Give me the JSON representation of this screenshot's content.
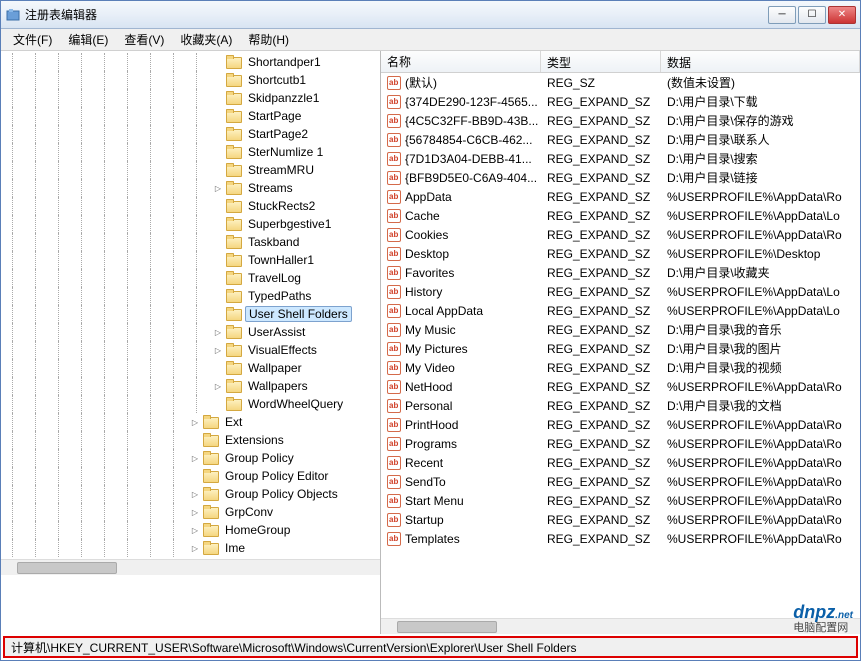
{
  "window": {
    "title": "注册表编辑器"
  },
  "menubar": {
    "items": [
      "文件(F)",
      "编辑(E)",
      "查看(V)",
      "收藏夹(A)",
      "帮助(H)"
    ]
  },
  "tree": {
    "items": [
      {
        "label": "Shortandper1",
        "indent": 9,
        "exp": false
      },
      {
        "label": "Shortcutb1",
        "indent": 9,
        "exp": false
      },
      {
        "label": "Skidpanzzle1",
        "indent": 9,
        "exp": false
      },
      {
        "label": "StartPage",
        "indent": 9,
        "exp": false
      },
      {
        "label": "StartPage2",
        "indent": 9,
        "exp": false
      },
      {
        "label": "SterNumlize 1",
        "indent": 9,
        "exp": false
      },
      {
        "label": "StreamMRU",
        "indent": 9,
        "exp": false
      },
      {
        "label": "Streams",
        "indent": 9,
        "exp": true
      },
      {
        "label": "StuckRects2",
        "indent": 9,
        "exp": false
      },
      {
        "label": "Superbgestive1",
        "indent": 9,
        "exp": false
      },
      {
        "label": "Taskband",
        "indent": 9,
        "exp": false
      },
      {
        "label": "TownHaller1",
        "indent": 9,
        "exp": false
      },
      {
        "label": "TravelLog",
        "indent": 9,
        "exp": false
      },
      {
        "label": "TypedPaths",
        "indent": 9,
        "exp": false
      },
      {
        "label": "User Shell Folders",
        "indent": 9,
        "exp": false,
        "selected": true
      },
      {
        "label": "UserAssist",
        "indent": 9,
        "exp": true
      },
      {
        "label": "VisualEffects",
        "indent": 9,
        "exp": true
      },
      {
        "label": "Wallpaper",
        "indent": 9,
        "exp": false
      },
      {
        "label": "Wallpapers",
        "indent": 9,
        "exp": true
      },
      {
        "label": "WordWheelQuery",
        "indent": 9,
        "exp": false
      },
      {
        "label": "Ext",
        "indent": 8,
        "exp": true
      },
      {
        "label": "Extensions",
        "indent": 8,
        "exp": false
      },
      {
        "label": "Group Policy",
        "indent": 8,
        "exp": true
      },
      {
        "label": "Group Policy Editor",
        "indent": 8,
        "exp": false
      },
      {
        "label": "Group Policy Objects",
        "indent": 8,
        "exp": true
      },
      {
        "label": "GrpConv",
        "indent": 8,
        "exp": true
      },
      {
        "label": "HomeGroup",
        "indent": 8,
        "exp": true
      },
      {
        "label": "Ime",
        "indent": 8,
        "exp": true
      }
    ]
  },
  "list": {
    "headers": [
      "名称",
      "类型",
      "数据"
    ],
    "rows": [
      {
        "name": "(默认)",
        "type": "REG_SZ",
        "data": "(数值未设置)"
      },
      {
        "name": "{374DE290-123F-4565...",
        "type": "REG_EXPAND_SZ",
        "data": "D:\\用户目录\\下载"
      },
      {
        "name": "{4C5C32FF-BB9D-43B...",
        "type": "REG_EXPAND_SZ",
        "data": "D:\\用户目录\\保存的游戏"
      },
      {
        "name": "{56784854-C6CB-462...",
        "type": "REG_EXPAND_SZ",
        "data": "D:\\用户目录\\联系人"
      },
      {
        "name": "{7D1D3A04-DEBB-41...",
        "type": "REG_EXPAND_SZ",
        "data": "D:\\用户目录\\搜索"
      },
      {
        "name": "{BFB9D5E0-C6A9-404...",
        "type": "REG_EXPAND_SZ",
        "data": "D:\\用户目录\\链接"
      },
      {
        "name": "AppData",
        "type": "REG_EXPAND_SZ",
        "data": "%USERPROFILE%\\AppData\\Ro"
      },
      {
        "name": "Cache",
        "type": "REG_EXPAND_SZ",
        "data": "%USERPROFILE%\\AppData\\Lo"
      },
      {
        "name": "Cookies",
        "type": "REG_EXPAND_SZ",
        "data": "%USERPROFILE%\\AppData\\Ro"
      },
      {
        "name": "Desktop",
        "type": "REG_EXPAND_SZ",
        "data": "%USERPROFILE%\\Desktop"
      },
      {
        "name": "Favorites",
        "type": "REG_EXPAND_SZ",
        "data": "D:\\用户目录\\收藏夹"
      },
      {
        "name": "History",
        "type": "REG_EXPAND_SZ",
        "data": "%USERPROFILE%\\AppData\\Lo"
      },
      {
        "name": "Local AppData",
        "type": "REG_EXPAND_SZ",
        "data": "%USERPROFILE%\\AppData\\Lo"
      },
      {
        "name": "My Music",
        "type": "REG_EXPAND_SZ",
        "data": "D:\\用户目录\\我的音乐"
      },
      {
        "name": "My Pictures",
        "type": "REG_EXPAND_SZ",
        "data": "D:\\用户目录\\我的图片"
      },
      {
        "name": "My Video",
        "type": "REG_EXPAND_SZ",
        "data": "D:\\用户目录\\我的视频"
      },
      {
        "name": "NetHood",
        "type": "REG_EXPAND_SZ",
        "data": "%USERPROFILE%\\AppData\\Ro"
      },
      {
        "name": "Personal",
        "type": "REG_EXPAND_SZ",
        "data": "D:\\用户目录\\我的文档"
      },
      {
        "name": "PrintHood",
        "type": "REG_EXPAND_SZ",
        "data": "%USERPROFILE%\\AppData\\Ro"
      },
      {
        "name": "Programs",
        "type": "REG_EXPAND_SZ",
        "data": "%USERPROFILE%\\AppData\\Ro"
      },
      {
        "name": "Recent",
        "type": "REG_EXPAND_SZ",
        "data": "%USERPROFILE%\\AppData\\Ro"
      },
      {
        "name": "SendTo",
        "type": "REG_EXPAND_SZ",
        "data": "%USERPROFILE%\\AppData\\Ro"
      },
      {
        "name": "Start Menu",
        "type": "REG_EXPAND_SZ",
        "data": "%USERPROFILE%\\AppData\\Ro"
      },
      {
        "name": "Startup",
        "type": "REG_EXPAND_SZ",
        "data": "%USERPROFILE%\\AppData\\Ro"
      },
      {
        "name": "Templates",
        "type": "REG_EXPAND_SZ",
        "data": "%USERPROFILE%\\AppData\\Ro"
      }
    ]
  },
  "statusbar": {
    "path": "计算机\\HKEY_CURRENT_USER\\Software\\Microsoft\\Windows\\CurrentVersion\\Explorer\\User Shell Folders"
  },
  "watermark": {
    "main": "dnpz",
    "sub": "电脑配置网",
    "dot": ".net"
  }
}
